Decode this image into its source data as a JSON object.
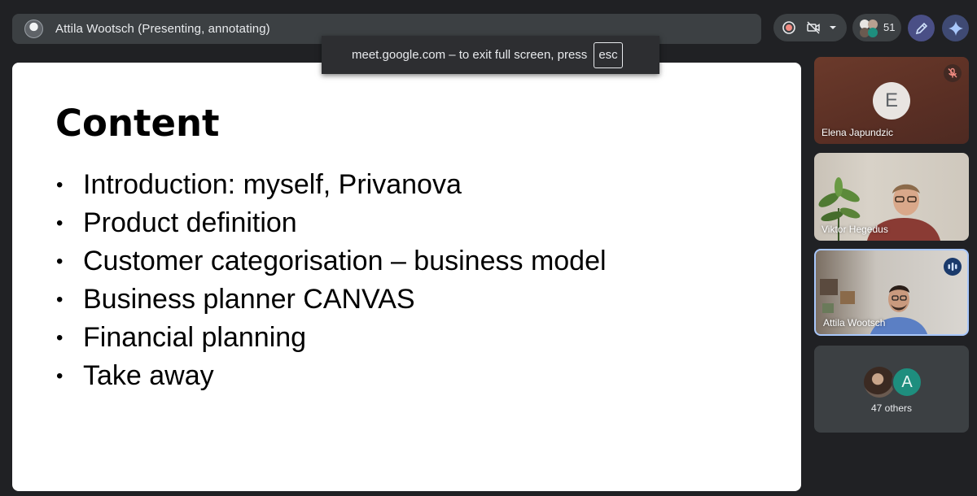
{
  "header": {
    "presenter_label": "Attila Wootsch (Presenting, annotating)",
    "people_count": "51",
    "icons": [
      "record-icon",
      "camera-off-icon",
      "chevron-down-icon",
      "annotate-pen-icon",
      "gemini-sparkle-icon"
    ]
  },
  "toast": {
    "message": "meet.google.com – to exit full screen, press",
    "key": "esc"
  },
  "slide": {
    "title": "Content",
    "bullets": [
      "Introduction: myself, Privanova",
      "Product definition",
      "Customer categorisation – business model",
      "Business planner CANVAS",
      "Financial planning",
      "Take away"
    ],
    "bullet_symbol": "•"
  },
  "participants": [
    {
      "name": "Elena Japundzic",
      "avatar_letter": "E",
      "muted": true
    },
    {
      "name": "Viktor Hegedus"
    },
    {
      "name": "Attila Wootsch",
      "speaking": true
    }
  ],
  "others": {
    "avatar_letter": "A",
    "label": "47 others"
  },
  "colors": {
    "background": "#202124",
    "bar": "#3c4043",
    "accent_border": "#a8c7fa",
    "muted_red": "#f28b82"
  }
}
